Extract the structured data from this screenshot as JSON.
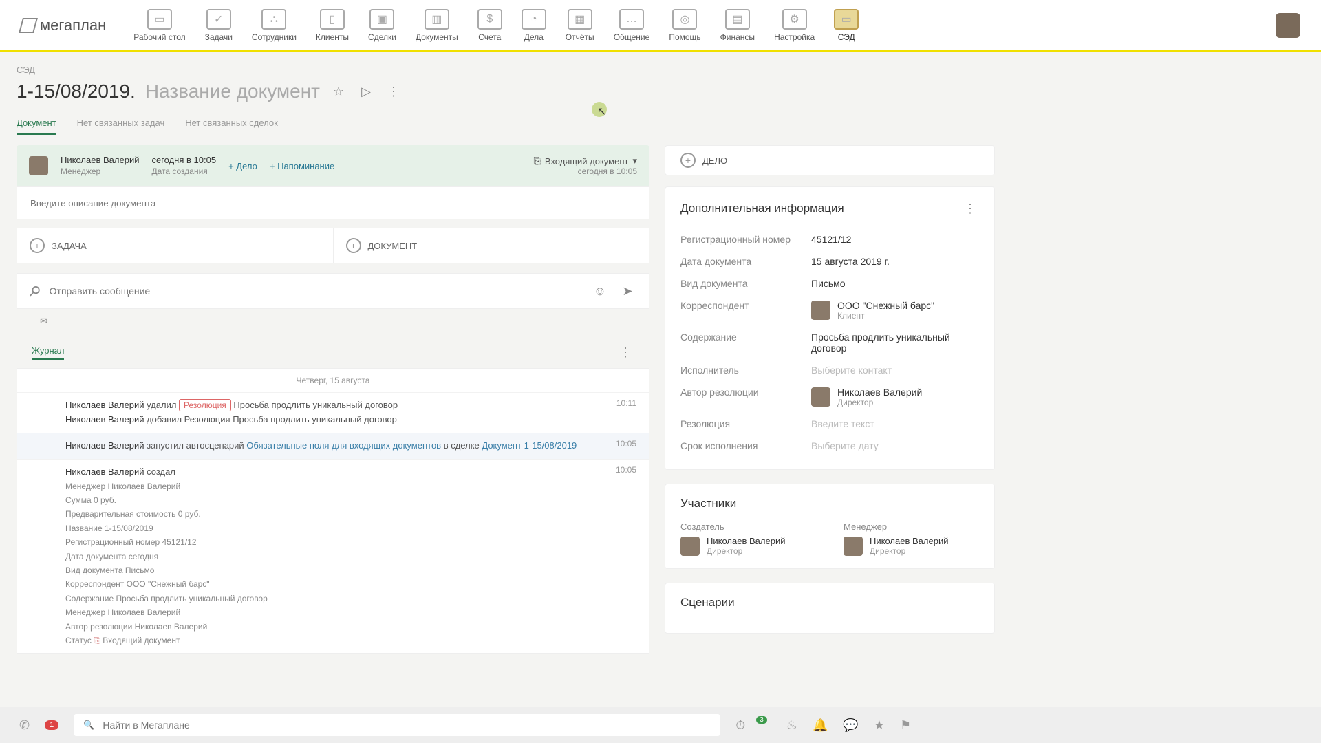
{
  "brand": "мегаплан",
  "nav": {
    "items": [
      {
        "label": "Рабочий стол"
      },
      {
        "label": "Задачи"
      },
      {
        "label": "Сотрудники"
      },
      {
        "label": "Клиенты"
      },
      {
        "label": "Сделки"
      },
      {
        "label": "Документы"
      },
      {
        "label": "Счета"
      },
      {
        "label": "Дела"
      },
      {
        "label": "Отчёты"
      },
      {
        "label": "Общение"
      },
      {
        "label": "Помощь"
      },
      {
        "label": "Финансы"
      },
      {
        "label": "Настройка"
      },
      {
        "label": "СЭД"
      }
    ]
  },
  "breadcrumb": "СЭД",
  "title": {
    "prefix": "1-15/08/2019. ",
    "name": "Название документ"
  },
  "tabs": [
    {
      "label": "Документ",
      "active": true
    },
    {
      "label": "Нет связанных задач"
    },
    {
      "label": "Нет связанных сделок"
    }
  ],
  "header": {
    "owner": {
      "name": "Николаев Валерий",
      "role": "Менеджер"
    },
    "created": {
      "value": "сегодня в 10:05",
      "label": "Дата создания"
    },
    "add_case": "+ Дело",
    "add_reminder": "+ Напоминание",
    "status": {
      "label": "Входящий документ",
      "time": "сегодня в 10:05"
    }
  },
  "desc_placeholder": "Введите описание документа",
  "split": {
    "task": "ЗАДАЧА",
    "doc": "ДОКУМЕНТ"
  },
  "msg": {
    "placeholder": "Отправить сообщение"
  },
  "journal": {
    "tab": "Журнал",
    "date": "Четверг, 15 августа",
    "items": [
      {
        "time": "10:11",
        "lines": [
          {
            "name": "Николаев Валерий",
            "action": "удалил",
            "tag": "Резолюция",
            "rest": "Просьба продлить уникальный договор"
          },
          {
            "name": "Николаев Валерий",
            "action": "добавил",
            "plain": "Резолюция",
            "rest": "Просьба продлить уникальный договор"
          }
        ]
      },
      {
        "time": "10:05",
        "lines": [
          {
            "name": "Николаев Валерий",
            "action": "запустил автосценарий",
            "link1": "Обязательные поля для входящих документов",
            "mid": " в сделке ",
            "link2": "Документ 1-15/08/2019"
          }
        ]
      },
      {
        "time": "10:05",
        "create": true,
        "name": "Николаев Валерий",
        "action": "создал",
        "details": [
          "Менеджер   Николаев Валерий",
          "Сумма   0 руб.",
          "Предварительная стоимость   0 руб.",
          "Название   1-15/08/2019",
          "Регистрационный номер   45121/12",
          "Дата документа   сегодня",
          "Вид документа   Письмо",
          "Корреспондент   ООО \"Снежный барс\"",
          "Содержание   Просьба продлить уникальный договор",
          "Менеджер   Николаев Валерий",
          "Автор резолюции   Николаев Валерий"
        ],
        "status_label": "Статус",
        "status_value": "Входящий документ"
      }
    ]
  },
  "sidebar": {
    "delo": "ДЕЛО",
    "info": {
      "title": "Дополнительная информация",
      "rows": [
        {
          "label": "Регистрационный номер",
          "value": "45121/12"
        },
        {
          "label": "Дата документа",
          "value": "15 августа 2019 г."
        },
        {
          "label": "Вид документа",
          "value": "Письмо"
        },
        {
          "label": "Корреспондент",
          "person": {
            "name": "ООО \"Снежный барс\"",
            "role": "Клиент"
          }
        },
        {
          "label": "Содержание",
          "value": "Просьба продлить уникальный договор"
        },
        {
          "label": "Исполнитель",
          "placeholder": "Выберите контакт"
        },
        {
          "label": "Автор резолюции",
          "person": {
            "name": "Николаев Валерий",
            "role": "Директор"
          }
        },
        {
          "label": "Резолюция",
          "placeholder": "Введите текст"
        },
        {
          "label": "Срок исполнения",
          "placeholder": "Выберите дату"
        }
      ]
    },
    "participants": {
      "title": "Участники",
      "creator": {
        "label": "Создатель",
        "name": "Николаев Валерий",
        "role": "Директор"
      },
      "manager": {
        "label": "Менеджер",
        "name": "Николаев Валерий",
        "role": "Директор"
      }
    },
    "scenarios": {
      "title": "Сценарии"
    }
  },
  "footer": {
    "phone_badge": "1",
    "search_placeholder": "Найти в Мегаплане",
    "clock_badge": "3"
  }
}
